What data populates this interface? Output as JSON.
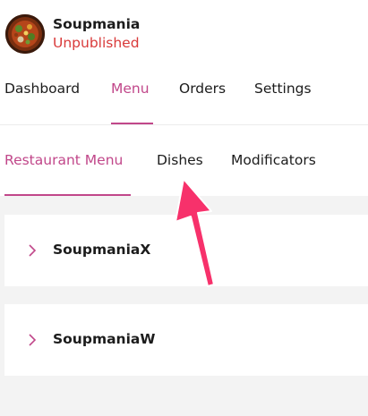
{
  "restaurant": {
    "name": "Soupmania",
    "status": "Unpublished"
  },
  "main_nav": {
    "tabs": [
      {
        "label": "Dashboard"
      },
      {
        "label": "Menu",
        "active": true
      },
      {
        "label": "Orders"
      },
      {
        "label": "Settings"
      }
    ]
  },
  "sub_nav": {
    "tabs": [
      {
        "label": "Restaurant Menu",
        "active": true
      },
      {
        "label": "Dishes"
      },
      {
        "label": "Modificators"
      }
    ]
  },
  "menus": [
    {
      "name": "SoupmaniaX",
      "icon": "chevron-right-icon"
    },
    {
      "name": "SoupmaniaW",
      "icon": "chevron-right-icon"
    }
  ],
  "colors": {
    "accent": "#c1478a",
    "status_unpublished": "#d93a3a",
    "annotation_arrow": "#f7316b",
    "content_background": "#f3f3f3"
  }
}
